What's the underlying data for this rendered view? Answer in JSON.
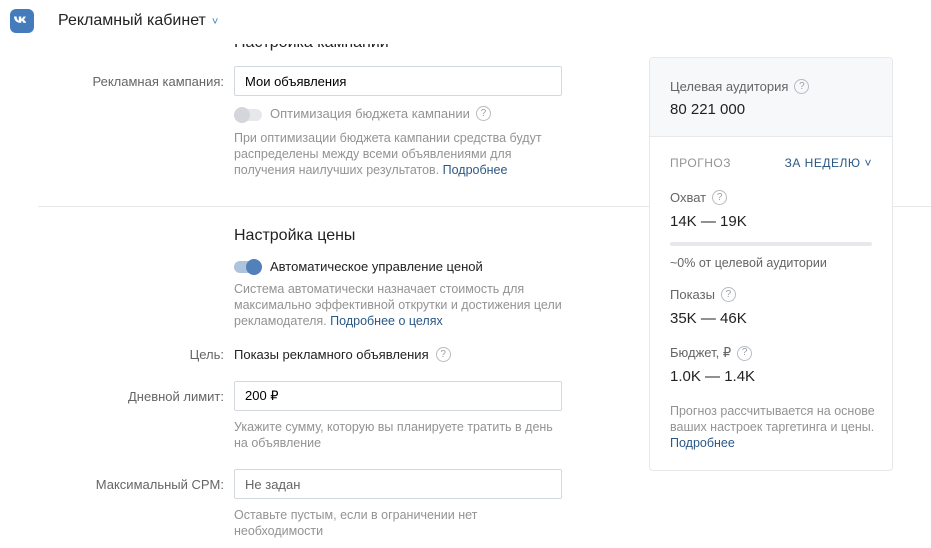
{
  "header": {
    "title": "Рекламный кабинет",
    "chevron": "˅"
  },
  "campaign_section": {
    "title": "Настройка кампании",
    "campaign_label": "Рекламная кампания:",
    "campaign_value": "Мои объявления",
    "budget_opt_label": "Оптимизация бюджета кампании",
    "budget_opt_on": false,
    "budget_hint": "При оптимизации бюджета кампании средства будут распределены между всеми объявлениями для получения наилучших результатов.",
    "budget_hint_link": "Подробнее"
  },
  "price_section": {
    "title": "Настройка цены",
    "auto_label": "Автоматическое управление ценой",
    "auto_on": true,
    "auto_hint": "Система автоматически назначает стоимость для максимально эффективной открутки и достижения цели рекламодателя.",
    "auto_hint_link": "Подробнее о целях",
    "goal_label": "Цель:",
    "goal_value": "Показы рекламного объявления",
    "daily_label": "Дневной лимит:",
    "daily_value": "200 ₽",
    "daily_hint": "Укажите сумму, которую вы планируете тратить в день на объявление",
    "cpm_label": "Максимальный CPM:",
    "cpm_placeholder": "Не задан",
    "cpm_hint": "Оставьте пустым, если в ограничении нет необходимости"
  },
  "panel": {
    "audience_label": "Целевая аудитория",
    "audience_value": "80 221 000",
    "forecast_label": "ПРОГНОЗ",
    "period_label": "ЗА НЕДЕЛЮ",
    "reach_label": "Охват",
    "reach_value": "14K — 19K",
    "reach_fraction": 0,
    "reach_share": "~0% от целевой аудитории",
    "impressions_label": "Показы",
    "impressions_value": "35K — 46K",
    "budget_label": "Бюджет, ₽",
    "budget_value": "1.0K — 1.4K",
    "note": "Прогноз рассчитывается на основе ваших настроек таргетинга и цены.",
    "note_link": "Подробнее"
  },
  "icons": {
    "logo": "vk-logo-icon",
    "help": "question-mark-icon",
    "help_glyph": "?"
  },
  "colors": {
    "accent": "#5181b8",
    "link": "#2a5885",
    "brand": "#447bba"
  }
}
